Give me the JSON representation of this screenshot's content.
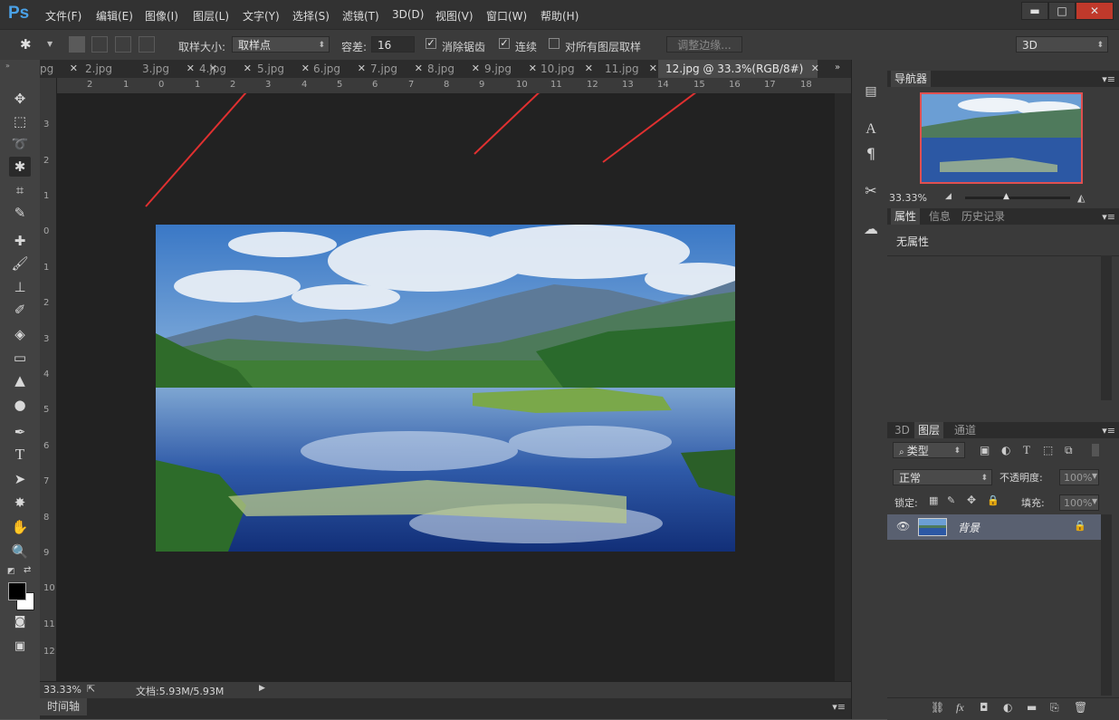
{
  "app": {
    "logo": "Ps"
  },
  "menu": [
    "文件(F)",
    "编辑(E)",
    "图像(I)",
    "图层(L)",
    "文字(Y)",
    "选择(S)",
    "滤镜(T)",
    "3D(D)",
    "视图(V)",
    "窗口(W)",
    "帮助(H)"
  ],
  "window_controls": {
    "minimize": "▬",
    "maximize": "□",
    "close": "✕"
  },
  "options": {
    "sample_size_label": "取样大小:",
    "sample_size_value": "取样点",
    "tolerance_label": "容差:",
    "tolerance_value": "16",
    "antialias_label": "消除锯齿",
    "contiguous_label": "连续",
    "all_layers_label": "对所有图层取样",
    "refine_edge_label": "调整边缘...",
    "workspace_value": "3D"
  },
  "tabs": [
    "pg",
    "2.jpg",
    "3.jpg",
    "4.jpg",
    "5.jpg",
    "6.jpg",
    "7.jpg",
    "8.jpg",
    "9.jpg",
    "10.jpg",
    "11.jpg",
    "12.jpg @ 33.3%(RGB/8#)"
  ],
  "ruler_h": [
    "2",
    "1",
    "0",
    "1",
    "2",
    "3",
    "4",
    "5",
    "6",
    "7",
    "8",
    "9",
    "10",
    "11",
    "12",
    "13",
    "14",
    "15",
    "16",
    "17",
    "18"
  ],
  "ruler_v": [
    "3",
    "2",
    "1",
    "0",
    "1",
    "2",
    "3",
    "4",
    "5",
    "6",
    "7",
    "8",
    "9",
    "10",
    "11",
    "12"
  ],
  "status": {
    "zoom": "33.33%",
    "doc": "文档:5.93M/5.93M"
  },
  "timeline": {
    "label": "时间轴"
  },
  "navigator": {
    "title": "导航器",
    "zoom": "33.33%"
  },
  "properties": {
    "tabs": [
      "属性",
      "信息",
      "历史记录"
    ],
    "empty_text": "无属性"
  },
  "layers": {
    "tabs": [
      "3D",
      "图层",
      "通道"
    ],
    "filter_label": "类型",
    "blend_mode": "正常",
    "opacity_label": "不透明度:",
    "opacity_value": "100%",
    "lock_label": "锁定:",
    "fill_label": "填充:",
    "fill_value": "100%",
    "layer_name": "背景"
  },
  "colors": {
    "accent": "#4aa1e6",
    "arrow": "#e03030",
    "nav_frame": "#e05050"
  }
}
